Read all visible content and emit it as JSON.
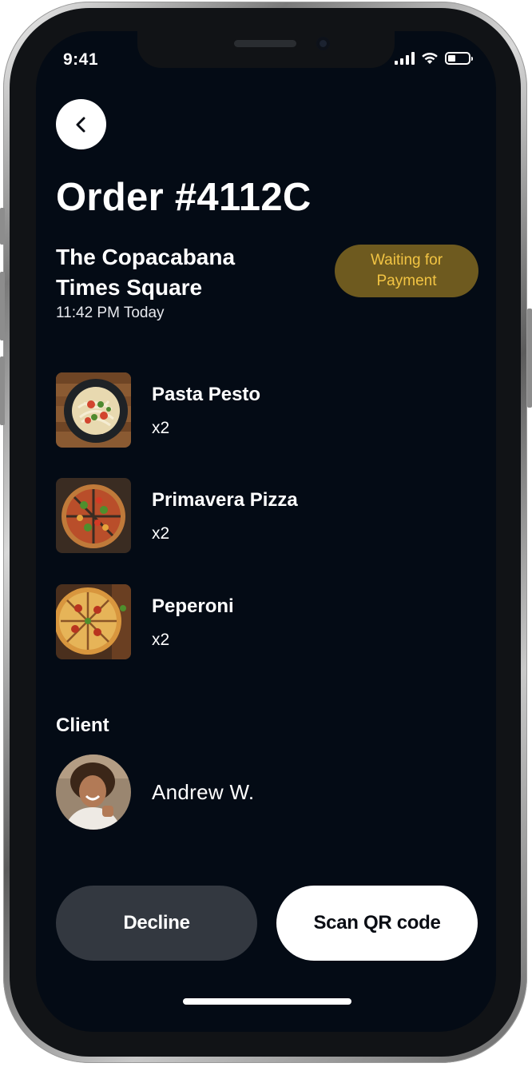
{
  "status_bar": {
    "time": "9:41"
  },
  "order": {
    "title": "Order #4112C",
    "venue": "The Copacabana Times Square",
    "time": "11:42 PM Today",
    "status": "Waiting for Payment"
  },
  "items": [
    {
      "name": "Pasta Pesto",
      "qty": "x2",
      "image": "pasta-photo"
    },
    {
      "name": "Primavera Pizza",
      "qty": "x2",
      "image": "pizza-photo"
    },
    {
      "name": "Peperoni",
      "qty": "x2",
      "image": "pepperoni-pizza-photo"
    }
  ],
  "client": {
    "label": "Client",
    "name": "Andrew W.",
    "avatar": "client-avatar-photo"
  },
  "actions": {
    "decline": "Decline",
    "scan": "Scan QR code"
  },
  "colors": {
    "screen_bg": "#040b15",
    "badge_bg": "#6e5a1f",
    "badge_text": "#f2c443",
    "decline_bg": "#333840",
    "scan_bg": "#ffffff"
  }
}
